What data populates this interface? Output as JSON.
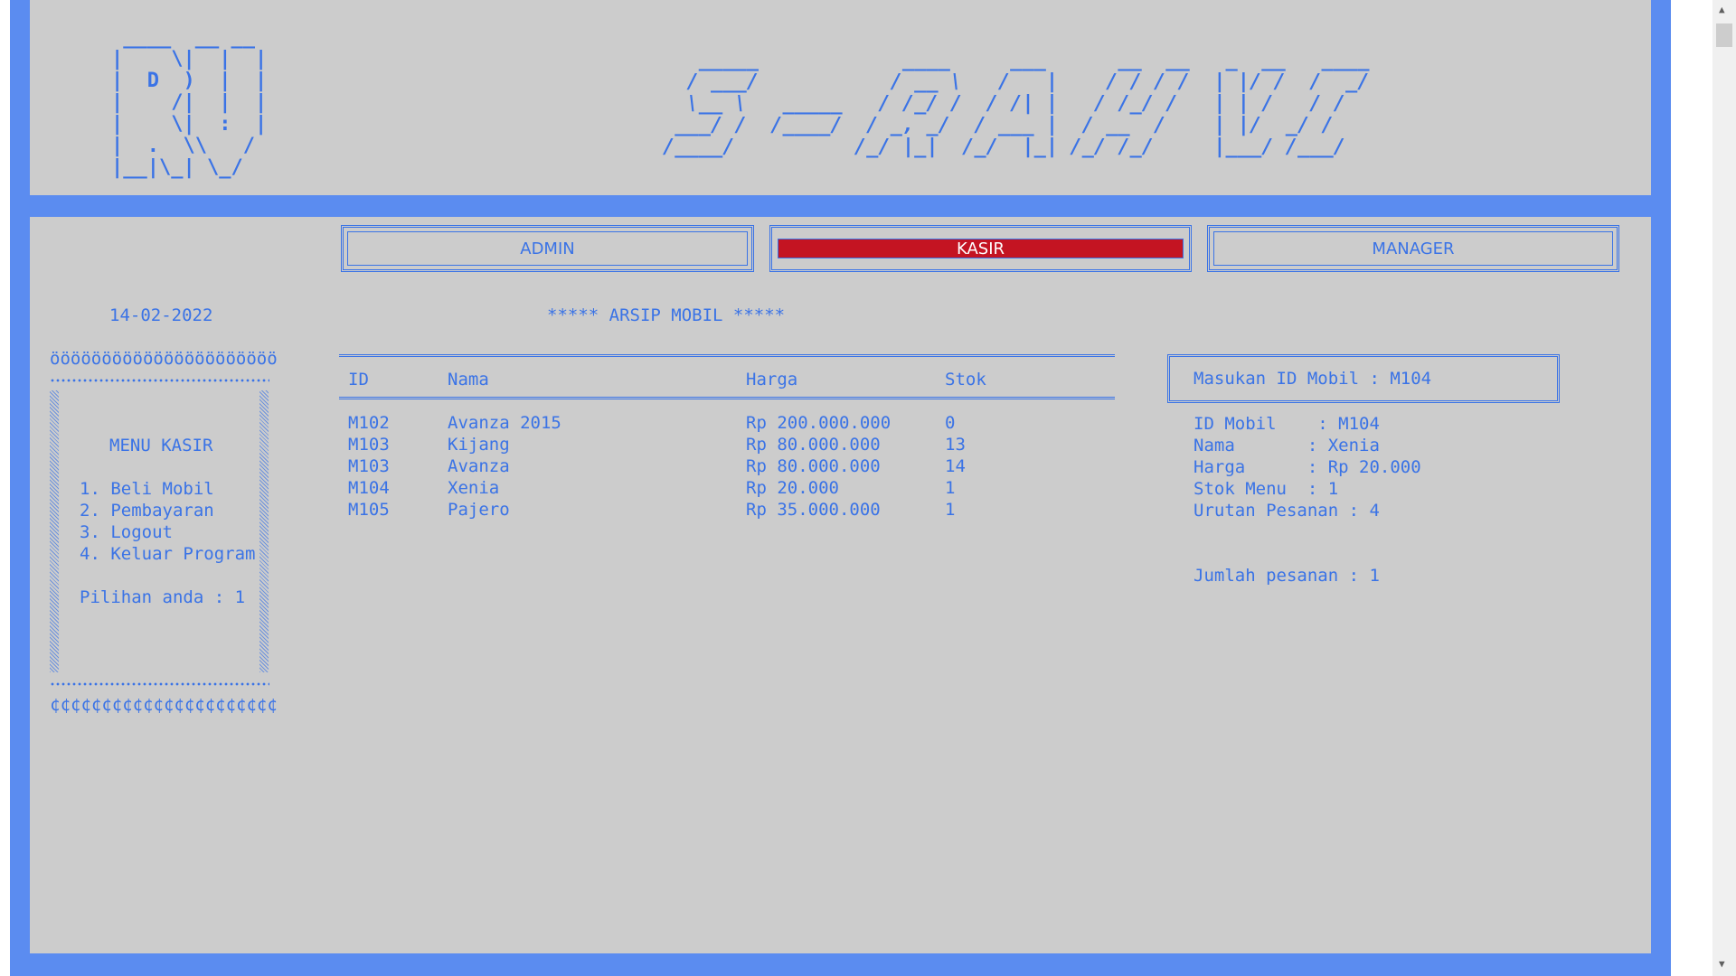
{
  "logo_ascii": " ____  __ __\n|    \\|  |  |\n|  D  )  |  |\n|    /|  |  |\n|    \\|  :  |\n|  .  \\\\   /\n|__|\\_| \\_/",
  "banner_ascii": "   _____            ____     ___      __  __   _  __   ____\n  / ___/           / __ \\   /   |    / / / /  | |/ /  /  _/\n  \\__ \\   _____   / /_/ /  / /| |   / /_/ /   | | /   / /\n ___/ /  /____/  / _, _/  / ___ |  / __  /    | |/  _/ /\n/____/          /_/ |_|  /_/  |_| /_/ /_/     |___/ /___/",
  "nav": {
    "admin_label": "ADMIN",
    "kasir_label": "KASIR",
    "manager_label": "MANAGER"
  },
  "date": "14-02-2022",
  "archive_title": "***** ARSIP MOBIL *****",
  "sidebar": {
    "top_border": "öööööööööööööööööööööö",
    "bottom_border": "¢¢¢¢¢¢¢¢¢¢¢¢¢¢¢¢¢¢¢¢¢¢",
    "menu_title": "MENU KASIR",
    "items": [
      "1. Beli Mobil",
      "2. Pembayaran",
      "3. Logout",
      "4. Keluar Program"
    ],
    "prompt": "Pilihan anda : 1"
  },
  "table": {
    "headers": [
      "ID",
      "Nama",
      "Harga",
      "Stok"
    ],
    "rows": [
      [
        "M102",
        "Avanza 2015",
        "Rp 200.000.000",
        "0"
      ],
      [
        "M103",
        "Kijang",
        "Rp 80.000.000",
        "13"
      ],
      [
        "M103",
        "Avanza",
        "Rp 80.000.000",
        "14"
      ],
      [
        "M104",
        "Xenia",
        "Rp 20.000",
        "1"
      ],
      [
        "M105",
        "Pajero",
        "Rp 35.000.000",
        "1"
      ]
    ]
  },
  "order": {
    "input_label": "Masukan ID Mobil : M104",
    "details": [
      "ID Mobil    : M104",
      "Nama       : Xenia",
      "Harga      : Rp 20.000",
      "Stok Menu  : 1",
      "Urutan Pesanan : 4"
    ],
    "total": "Jumlah pesanan : 1"
  },
  "colors": {
    "accent": "#3a73e6",
    "frame": "#5b8cf0",
    "panel": "#cccccc",
    "active_tab": "#c41422"
  }
}
